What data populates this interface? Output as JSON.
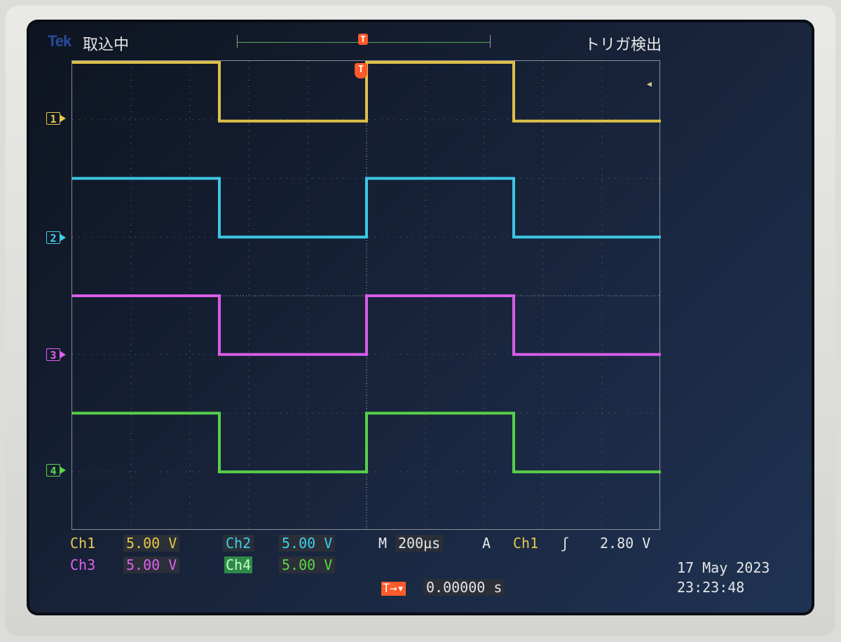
{
  "header": {
    "brand": "Tek",
    "acquisition_status": "取込中",
    "trigger_status": "トリガ検出",
    "trigger_marker": "T"
  },
  "channels": [
    {
      "marker": "1",
      "label": "Ch1",
      "scale": "5.00 V",
      "color": "#e8c84a"
    },
    {
      "marker": "2",
      "label": "Ch2",
      "scale": "5.00 V",
      "color": "#3ed0ee"
    },
    {
      "marker": "3",
      "label": "Ch3",
      "scale": "5.00 V",
      "color": "#e060f0"
    },
    {
      "marker": "4",
      "label": "Ch4",
      "scale": "5.00 V",
      "color": "#5cd84a"
    }
  ],
  "timebase": {
    "label": "M",
    "value": "200µs"
  },
  "trigger": {
    "label": "A",
    "source": "Ch1",
    "slope_icon": "rising-edge-icon",
    "slope_glyph": "ʃ",
    "level": "2.80 V"
  },
  "trigger_position": {
    "symbol": "T→▾",
    "value": "0.00000 s"
  },
  "timestamp": {
    "date": "17 May 2023",
    "time": "23:23:48"
  },
  "waveform": {
    "type": "square",
    "periods_visible": 2,
    "duty_cycle": 0.5,
    "high_divisions_above_ground": 1.0,
    "edges_divisions": [
      0,
      2.5,
      5.0,
      7.5,
      10.0
    ]
  }
}
